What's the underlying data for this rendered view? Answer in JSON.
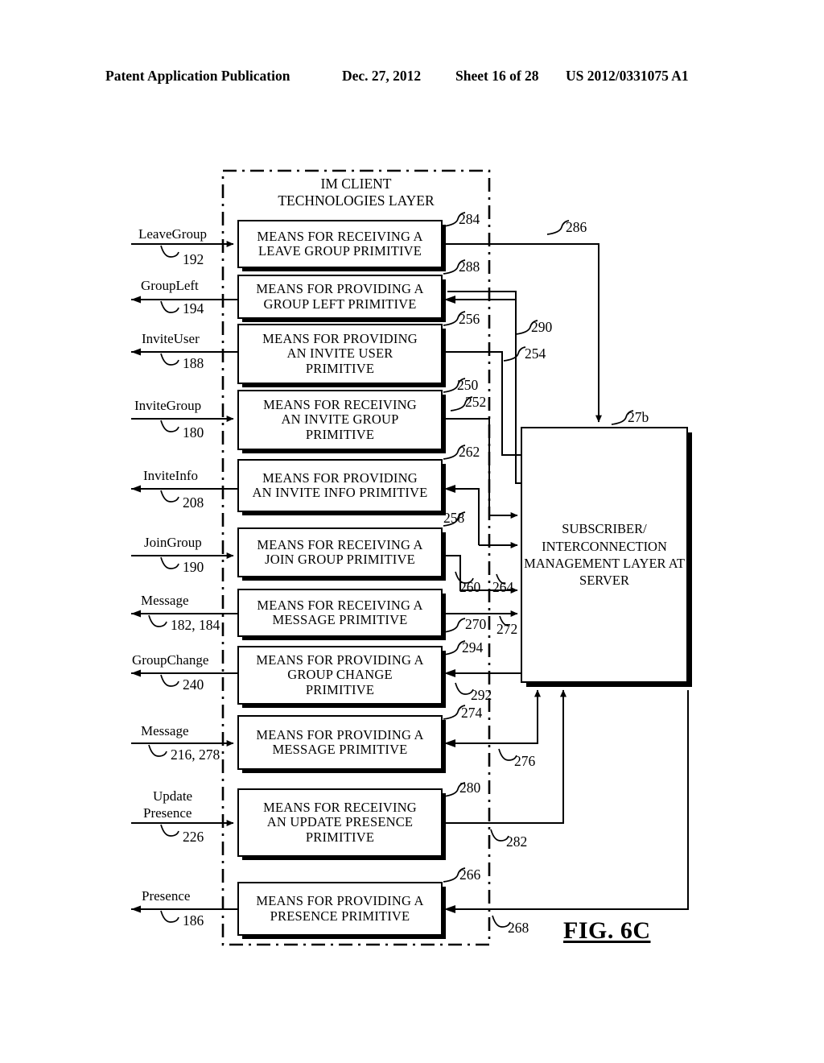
{
  "header": {
    "publication": "Patent Application Publication",
    "date": "Dec. 27, 2012",
    "sheet": "Sheet 16 of 28",
    "number": "US 2012/0331075 A1"
  },
  "figure": {
    "label": "FIG. 6C",
    "layer_title_line1": "IM CLIENT",
    "layer_title_line2": "TECHNOLOGIES LAYER"
  },
  "server": {
    "line1": "SUBSCRIBER/",
    "line2": "INTERCONNECTION",
    "line3": "MANAGEMENT",
    "line4": "LAYER AT SERVER",
    "ref": "27b"
  },
  "boxes": [
    {
      "id": "leave-group-recv",
      "ref": "284",
      "lines": [
        "MEANS FOR RECEIVING A",
        "LEAVE GROUP PRIMITIVE"
      ]
    },
    {
      "id": "group-left-prov",
      "ref": "288",
      "lines": [
        "MEANS FOR PROVIDING A",
        "GROUP LEFT PRIMITIVE"
      ]
    },
    {
      "id": "invite-user-prov",
      "ref": "256",
      "lines": [
        "MEANS FOR PROVIDING",
        "AN INVITE USER",
        "PRIMITIVE"
      ]
    },
    {
      "id": "invite-group-recv",
      "ref": "250",
      "lines": [
        "MEANS FOR RECEIVING",
        "AN INVITE GROUP",
        "PRIMITIVE"
      ]
    },
    {
      "id": "invite-info-prov",
      "ref": "262",
      "lines": [
        "MEANS FOR PROVIDING",
        "AN INVITE INFO PRIMITIVE"
      ]
    },
    {
      "id": "join-group-recv",
      "ref": "258",
      "lines": [
        "MEANS FOR RECEIVING A",
        "JOIN GROUP PRIMITIVE"
      ]
    },
    {
      "id": "message-recv",
      "ref": "270",
      "lines": [
        "MEANS FOR RECEIVING A",
        "MESSAGE PRIMITIVE"
      ]
    },
    {
      "id": "group-change-prov",
      "ref": "294",
      "lines": [
        "MEANS FOR PROVIDING A",
        "GROUP CHANGE",
        "PRIMITIVE"
      ]
    },
    {
      "id": "message-prov",
      "ref": "274",
      "lines": [
        "MEANS FOR PROVIDING A",
        "MESSAGE PRIMITIVE"
      ]
    },
    {
      "id": "update-presence-recv",
      "ref": "280",
      "lines": [
        "MEANS FOR RECEIVING",
        "AN UPDATE PRESENCE",
        "PRIMITIVE"
      ]
    },
    {
      "id": "presence-prov",
      "ref": "266",
      "lines": [
        "MEANS FOR PROVIDING A",
        "PRESENCE PRIMITIVE"
      ]
    }
  ],
  "signals": [
    {
      "id": "leave-group",
      "label": "LeaveGroup",
      "ref": "192",
      "direction": "in"
    },
    {
      "id": "group-left",
      "label": "GroupLeft",
      "ref": "194",
      "direction": "out"
    },
    {
      "id": "invite-user",
      "label": "InviteUser",
      "ref": "188",
      "direction": "out"
    },
    {
      "id": "invite-group",
      "label": "InviteGroup",
      "ref": "180",
      "direction": "in"
    },
    {
      "id": "invite-info",
      "label": "InviteInfo",
      "ref": "208",
      "direction": "out"
    },
    {
      "id": "join-group",
      "label": "JoinGroup",
      "ref": "190",
      "direction": "in"
    },
    {
      "id": "message-out",
      "label": "Message",
      "ref": "182, 184",
      "direction": "out"
    },
    {
      "id": "group-change",
      "label": "GroupChange",
      "ref": "240",
      "direction": "out"
    },
    {
      "id": "message-in",
      "label": "Message",
      "ref": "216, 278",
      "direction": "in"
    },
    {
      "id": "update-presence",
      "label": "Update Presence",
      "label_l1": "Update",
      "label_l2": "Presence",
      "ref": "226",
      "direction": "in"
    },
    {
      "id": "presence",
      "label": "Presence",
      "ref": "186",
      "direction": "out"
    }
  ],
  "connector_refs": [
    {
      "id": "c286",
      "value": "286"
    },
    {
      "id": "c290",
      "value": "290"
    },
    {
      "id": "c254",
      "value": "254"
    },
    {
      "id": "c252",
      "value": "252"
    },
    {
      "id": "c260",
      "value": "260"
    },
    {
      "id": "c264",
      "value": "264"
    },
    {
      "id": "c272",
      "value": "272"
    },
    {
      "id": "c292",
      "value": "292"
    },
    {
      "id": "c276",
      "value": "276"
    },
    {
      "id": "c282",
      "value": "282"
    },
    {
      "id": "c268",
      "value": "268"
    }
  ]
}
